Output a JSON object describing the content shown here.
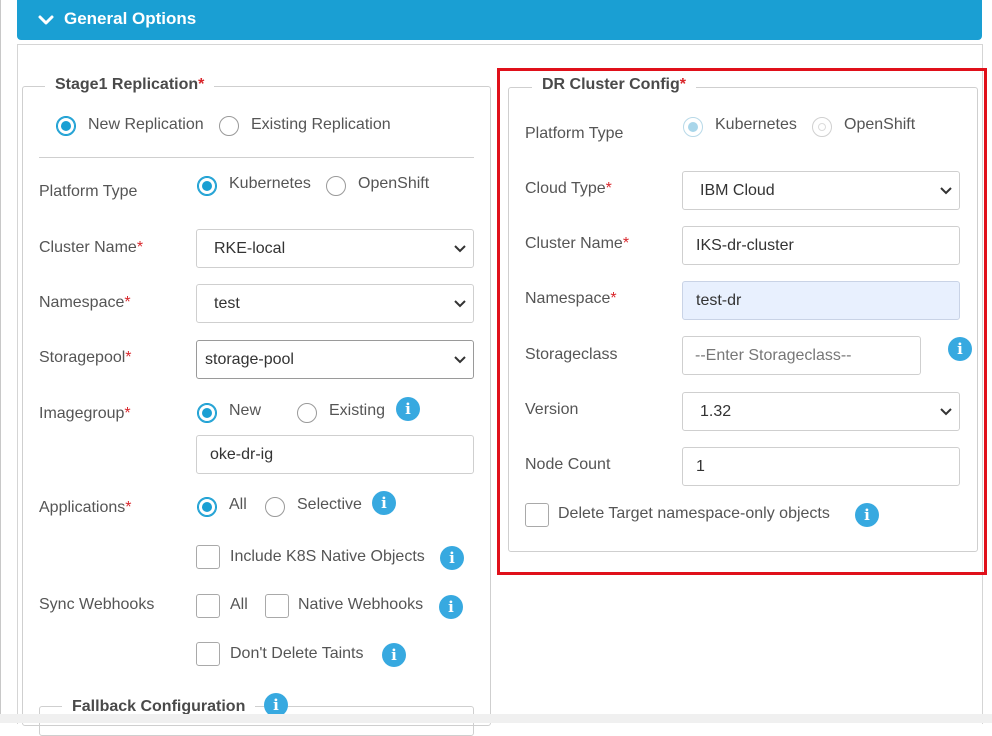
{
  "header": {
    "title": "General Options"
  },
  "stage1": {
    "legend": "Stage1 Replication",
    "replication_options": [
      "New Replication",
      "Existing Replication"
    ],
    "platform_type_label": "Platform Type",
    "platform_options": [
      "Kubernetes",
      "OpenShift"
    ],
    "cluster_name_label": "Cluster Name",
    "cluster_name_value": "RKE-local",
    "namespace_label": "Namespace",
    "namespace_value": "test",
    "storagepool_label": "Storagepool",
    "storagepool_value": "storage-pool",
    "imagegroup_label": "Imagegroup",
    "imagegroup_options": [
      "New",
      "Existing"
    ],
    "imagegroup_value": "oke-dr-ig",
    "applications_label": "Applications",
    "applications_options": [
      "All",
      "Selective"
    ],
    "include_native_label": "Include K8S Native Objects",
    "sync_webhooks_label": "Sync Webhooks",
    "webhook_all_label": "All",
    "native_webhooks_label": "Native Webhooks",
    "dont_delete_taints_label": "Don't Delete Taints",
    "fallback_label": "Fallback Configuration"
  },
  "dr": {
    "legend": "DR Cluster Config",
    "platform_type_label": "Platform Type",
    "platform_options": [
      "Kubernetes",
      "OpenShift"
    ],
    "cloud_type_label": "Cloud Type",
    "cloud_type_value": "IBM Cloud",
    "cluster_name_label": "Cluster Name",
    "cluster_name_value": "IKS-dr-cluster",
    "namespace_label": "Namespace",
    "namespace_value": "test-dr",
    "storageclass_label": "Storageclass",
    "storageclass_placeholder": "--Enter Storageclass--",
    "version_label": "Version",
    "version_value": "1.32",
    "node_count_label": "Node Count",
    "node_count_value": "1",
    "delete_target_label": "Delete Target namespace-only objects"
  },
  "colors": {
    "accent": "#1a9fd3",
    "required": "#d9262b",
    "highlight_border": "#e0101a",
    "info": "#37a9e0"
  },
  "icons": {
    "collapse": "chevron-down-icon",
    "info": "info-icon",
    "dropdown": "caret-down-icon"
  }
}
